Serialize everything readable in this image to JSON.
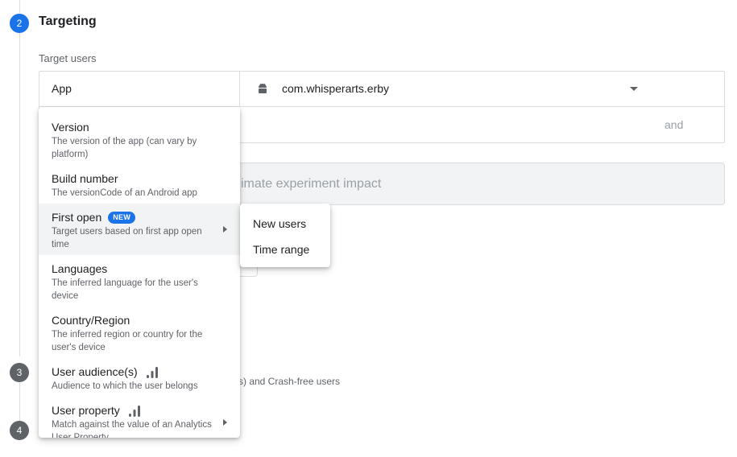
{
  "step2": {
    "number": "2",
    "title": "Targeting"
  },
  "step3": {
    "number": "3"
  },
  "step4": {
    "number": "4"
  },
  "target_users": {
    "label": "Target users",
    "row1_label": "App",
    "app_id": "com.whisperarts.erby",
    "and_label": "and"
  },
  "estimate": {
    "visible_text": "imate experiment impact"
  },
  "metric_hint": "s) and Crash-free users",
  "menu": {
    "items": [
      {
        "title": "Version",
        "desc": "The version of the app (can vary by platform)"
      },
      {
        "title": "Build number",
        "desc": "The versionCode of an Android app"
      },
      {
        "title": "First open",
        "badge": "NEW",
        "desc": "Target users based on first app open time"
      },
      {
        "title": "Languages",
        "desc": "The inferred language for the user's device"
      },
      {
        "title": "Country/Region",
        "desc": "The inferred region or country for the user's device"
      },
      {
        "title": "User audience(s)",
        "desc": "Audience to which the user belongs"
      },
      {
        "title": "User property",
        "desc": "Match against the value of an Analytics User Property"
      }
    ]
  },
  "submenu": {
    "items": [
      "New users",
      "Time range"
    ]
  },
  "colors": {
    "accent": "#1a73e8",
    "step_inactive": "#5f6368",
    "highlight": "#f1f3f4"
  }
}
